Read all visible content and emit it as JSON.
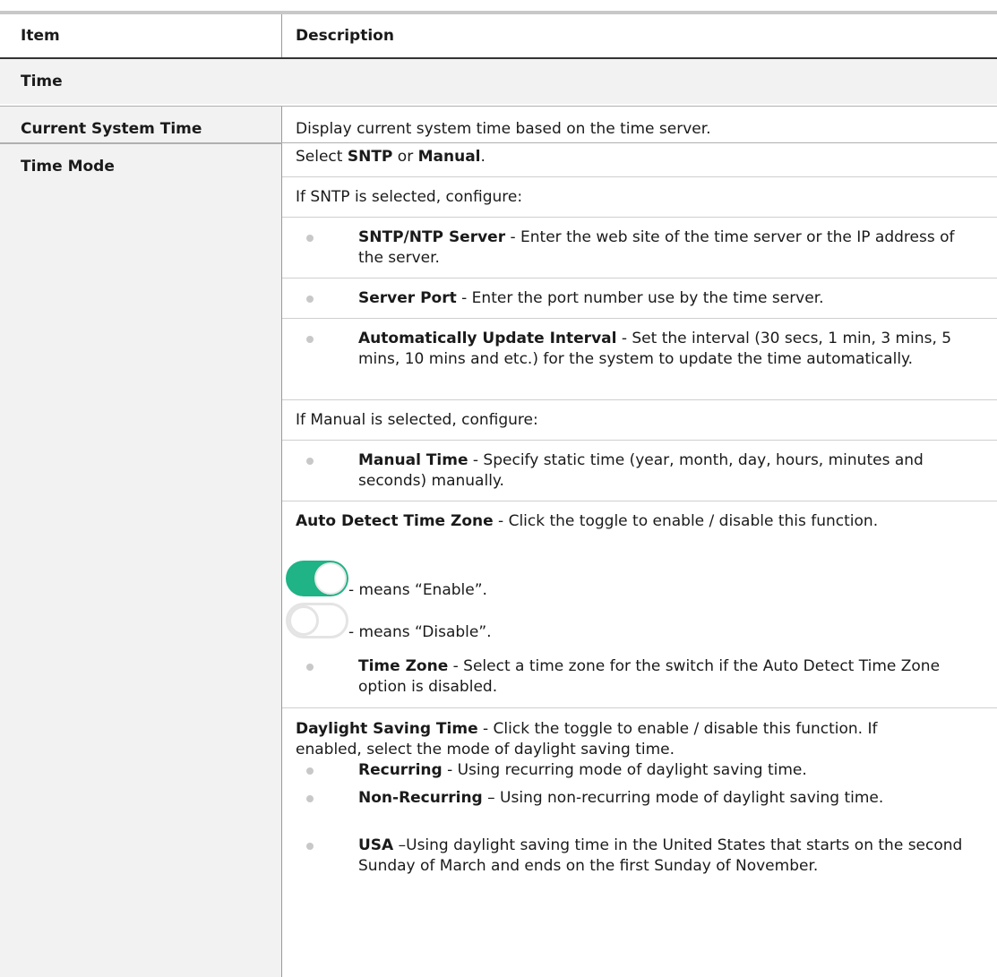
{
  "header": {
    "item": "Item",
    "description": "Description"
  },
  "section": {
    "title": "Time"
  },
  "current_system_time": {
    "item": "Current System Time",
    "description": "Display current system time based on the time server."
  },
  "time_mode": {
    "item": "Time Mode",
    "select": {
      "pre": "Select ",
      "sntp": "SNTP",
      "mid": " or ",
      "manual": "Manual",
      "post": "."
    },
    "sntp_intro": "If SNTP is selected, configure:",
    "sntp_items": [
      {
        "term": "SNTP/NTP Server",
        "text": " - Enter the web site of the time server or the IP address of the server."
      },
      {
        "term": "Server Port",
        "text": " - Enter the port number use by the time server."
      },
      {
        "term": "Automatically Update Interval",
        "text": " - Set the interval (30 secs, 1 min, 3 mins, 5 mins, 10 mins and etc.) for the system to update the time automatically."
      }
    ],
    "manual_intro": "If Manual is selected, configure:",
    "manual_items": [
      {
        "term": "Manual Time",
        "text": " - Specify static time (year, month, day, hours, minutes and seconds) manually."
      }
    ],
    "auto_detect": {
      "term": "Auto Detect Time Zone",
      "text": " - Click the toggle to enable / disable this function."
    },
    "toggle_enable": {
      "text": "- means “Enable”.",
      "state": "on",
      "color": "#1fb386"
    },
    "toggle_disable": {
      "text": "- means “Disable”.",
      "state": "off"
    },
    "timezone_item": {
      "term": "Time Zone",
      "text": " - Select a time zone for the switch if the Auto Detect Time Zone option is disabled."
    },
    "dst": {
      "term": "Daylight Saving Time",
      "text": " - Click the toggle to enable / disable this function. If enabled, select the mode of daylight saving time."
    },
    "dst_items": [
      {
        "term": "Recurring",
        "text": " - Using recurring mode of daylight saving time."
      },
      {
        "term": "Non-Recurring",
        "text": " – Using non-recurring mode of daylight saving time."
      },
      {
        "term": "USA",
        "text": " –Using daylight saving time in the United States that starts on the second Sunday of March and ends on the first Sunday of November."
      }
    ]
  }
}
